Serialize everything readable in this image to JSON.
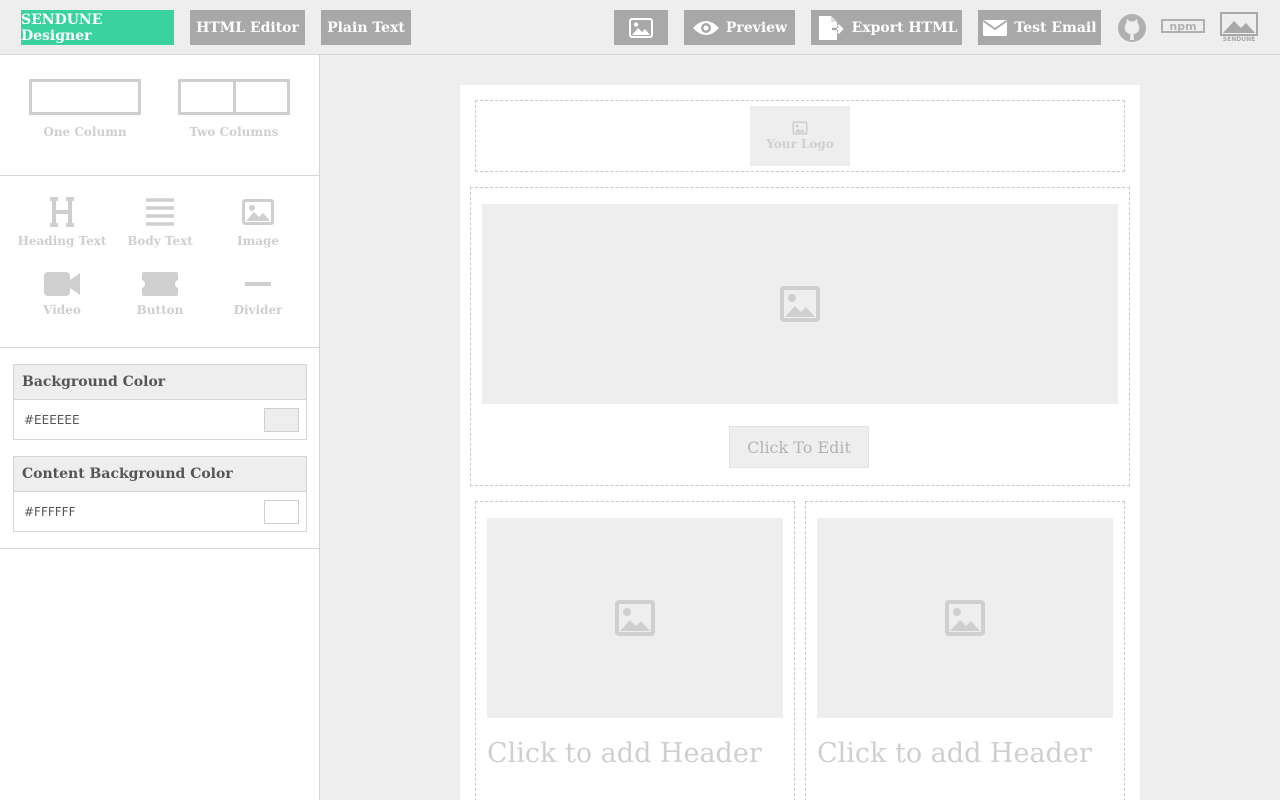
{
  "toolbar": {
    "designer_label": "SENDUNE Designer",
    "html_editor_label": "HTML Editor",
    "plain_text_label": "Plain Text",
    "preview_label": "Preview",
    "export_label": "Export HTML",
    "test_email_label": "Test Email",
    "brand_label": "SENDUNE",
    "npm_label": "npm"
  },
  "layouts": {
    "one_column": "One Column",
    "two_columns": "Two Columns"
  },
  "blocks": {
    "heading": "Heading Text",
    "body": "Body Text",
    "image": "Image",
    "video": "Video",
    "button": "Button",
    "divider": "Divider"
  },
  "settings": {
    "background": {
      "label": "Background Color",
      "value": "#EEEEEE",
      "color": "#eeeeee"
    },
    "content_background": {
      "label": "Content Background Color",
      "value": "#FFFFFF",
      "color": "#ffffff"
    }
  },
  "canvas": {
    "logo_text": "Your Logo",
    "edit_button": "Click To Edit",
    "left_header": "Click to add Header",
    "right_header": "Click to add Header"
  },
  "colors": {
    "accent": "#3ad29f",
    "button_gray": "#a8a8a8",
    "placeholder": "#eeeeee"
  }
}
